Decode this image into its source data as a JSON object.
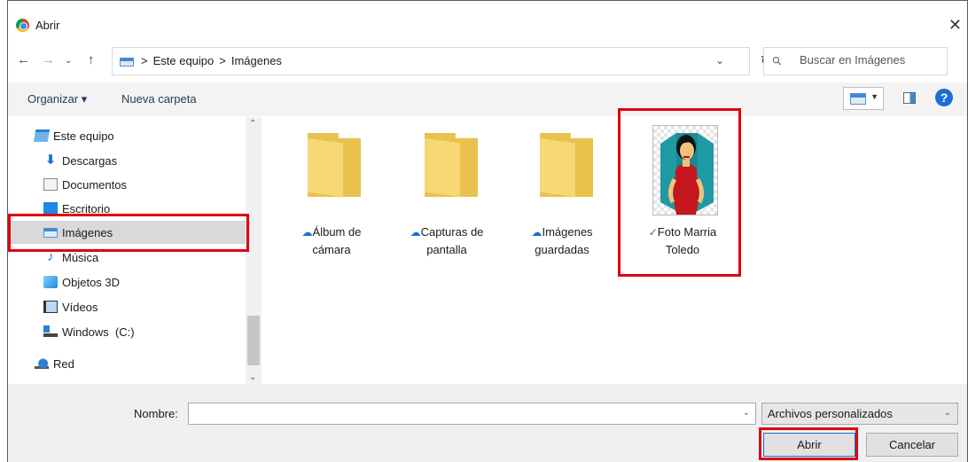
{
  "window": {
    "title": "Abrir",
    "app_icon": "chrome-icon",
    "close_icon": "close-icon"
  },
  "nav": {
    "back_icon": "arrow-left-icon",
    "forward_icon": "arrow-right-icon",
    "recent_icon": "chevron-down-icon",
    "up_icon": "arrow-up-icon",
    "breadcrumbs": [
      "Este equipo",
      "Imágenes"
    ],
    "separator": ">",
    "refresh_icon": "refresh-icon"
  },
  "search": {
    "placeholder": "Buscar en Imágenes"
  },
  "toolbar": {
    "organize": "Organizar ▾",
    "new_folder": "Nueva carpeta",
    "help": "?"
  },
  "sidebar": {
    "items": [
      {
        "label": "Este equipo",
        "icon": "computer-icon"
      },
      {
        "label": "Descargas",
        "icon": "download-icon"
      },
      {
        "label": "Documentos",
        "icon": "documents-icon"
      },
      {
        "label": "Escritorio",
        "icon": "desktop-icon"
      },
      {
        "label": "Imágenes",
        "icon": "pictures-icon",
        "selected": true
      },
      {
        "label": "Música",
        "icon": "music-icon"
      },
      {
        "label": "Objetos 3D",
        "icon": "3d-objects-icon"
      },
      {
        "label": "Vídeos",
        "icon": "videos-icon"
      },
      {
        "label": "Windows  (C:)",
        "icon": "drive-icon"
      },
      {
        "label": "Red",
        "icon": "network-icon"
      }
    ]
  },
  "files": [
    {
      "line1": "Álbum de",
      "line2": "cámara",
      "status_icon": "cloud-icon",
      "type": "folder"
    },
    {
      "line1": "Capturas de",
      "line2": "pantalla",
      "status_icon": "cloud-icon",
      "type": "folder"
    },
    {
      "line1": "Imágenes",
      "line2": "guardadas",
      "status_icon": "cloud-icon",
      "type": "folder"
    },
    {
      "line1": "Foto Marria",
      "line2": "Toledo",
      "status_icon": "check-circle-icon",
      "type": "image"
    }
  ],
  "footer": {
    "name_label": "Nombre:",
    "name_value": "",
    "file_type": "Archivos personalizados",
    "open_button": "Abrir",
    "cancel_button": "Cancelar"
  },
  "colors": {
    "highlight": "#e0000f",
    "accent": "#1a6ed6",
    "folder": "#f8d775"
  }
}
